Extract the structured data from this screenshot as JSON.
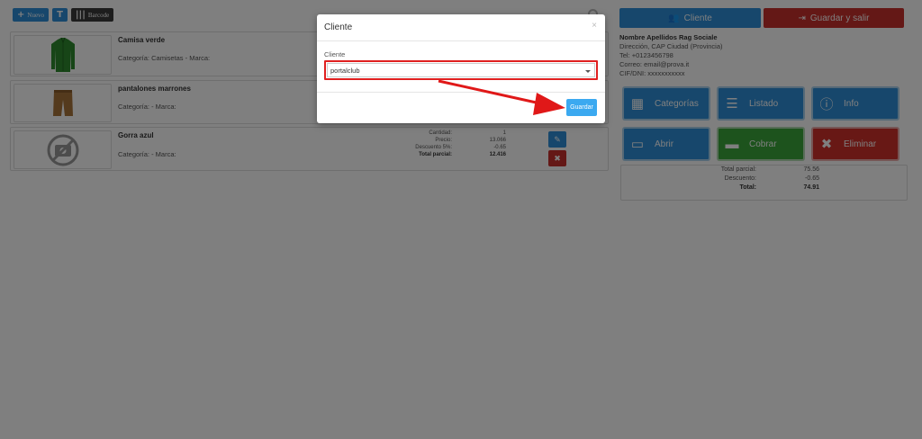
{
  "toolbar": {
    "new_label": "Nuevo",
    "barcode_label": "Barcode"
  },
  "products": [
    {
      "name": "Camisa verde",
      "category": "Categoría: Camisetas - Marca:"
    },
    {
      "name": "pantalones marrones",
      "category": "Categoría: - Marca:"
    },
    {
      "name": "Gorra azul",
      "category": "Categoría: - Marca:",
      "details": [
        {
          "label": "Cantidad:",
          "value": "1"
        },
        {
          "label": "Precio:",
          "value": "13.066"
        },
        {
          "label": "Descuento 5%:",
          "value": "-0.65"
        },
        {
          "label": "Total parcial:",
          "value": "12.416"
        }
      ]
    }
  ],
  "right": {
    "client_button": "Cliente",
    "save_exit_button": "Guardar y salir",
    "client_info": {
      "name": "Nombre Apellidos Rag Sociale",
      "address": "Dirección, CAP Ciudad (Provincia)",
      "phone": "Tel: +0123456798",
      "email": "Correo: email@prova.it",
      "cif": "CIF/DNI: xxxxxxxxxxx"
    },
    "actions": {
      "categories": "Categorías",
      "list": "Listado",
      "info": "Info",
      "open": "Abrir",
      "charge": "Cobrar",
      "delete": "Eliminar"
    },
    "totals": [
      {
        "label": "Total parcial:",
        "value": "75.56"
      },
      {
        "label": "Descuento:",
        "value": "-0.65"
      },
      {
        "label": "Total:",
        "value": "74.91"
      }
    ]
  },
  "modal": {
    "title": "Cliente",
    "close": "×",
    "field_label": "Cliente",
    "selected_value": "portalclub",
    "save_button": "Guardar"
  },
  "colors": {
    "primary": "#2f8fd8",
    "danger": "#d0302b",
    "success": "#3aa63a",
    "highlight": "#e02020"
  }
}
